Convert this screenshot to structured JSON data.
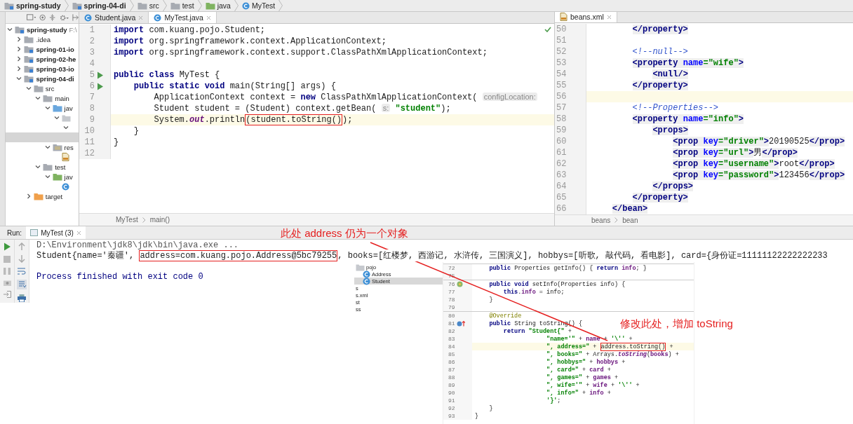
{
  "breadcrumbs": [
    {
      "label": "spring-study",
      "kind": "module"
    },
    {
      "label": "spring-04-di",
      "kind": "module"
    },
    {
      "label": "src",
      "kind": "folder"
    },
    {
      "label": "test",
      "kind": "folder"
    },
    {
      "label": "java",
      "kind": "testsource"
    },
    {
      "label": "MyTest",
      "kind": "class"
    }
  ],
  "project_tree": [
    {
      "label": "spring-study",
      "note": "F:\\",
      "kind": "module",
      "expanded": true,
      "selected": false,
      "children": [
        {
          "label": ".idea",
          "kind": "folder",
          "expanded": false,
          "selected": false
        },
        {
          "label": "spring-01-io",
          "kind": "module",
          "expanded": false,
          "selected": false
        },
        {
          "label": "spring-02-he",
          "kind": "module",
          "expanded": false,
          "selected": false
        },
        {
          "label": "spring-03-io",
          "kind": "module",
          "expanded": false,
          "selected": false
        },
        {
          "label": "spring-04-di",
          "kind": "module",
          "expanded": true,
          "selected": false,
          "children": [
            {
              "label": "src",
              "kind": "folder",
              "expanded": true,
              "selected": false,
              "children": [
                {
                  "label": "main",
                  "kind": "folder",
                  "expanded": true,
                  "selected": false,
                  "children": [
                    {
                      "label": "jav",
                      "kind": "source",
                      "expanded": true,
                      "selected": false,
                      "children": [
                        {
                          "kind": "package",
                          "expanded": true,
                          "selected": false,
                          "children": [
                            {
                              "expanded": true,
                              "selected": false,
                              "children": [
                                {
                                  "selected": true
                                }
                              ]
                            }
                          ]
                        }
                      ]
                    },
                    {
                      "label": "res",
                      "kind": "resources",
                      "expanded": true,
                      "selected": false,
                      "children": [
                        {
                          "kind": "xml",
                          "selected": false
                        }
                      ]
                    }
                  ]
                },
                {
                  "label": "test",
                  "kind": "folder",
                  "expanded": true,
                  "selected": false,
                  "children": [
                    {
                      "label": "jav",
                      "kind": "testsource",
                      "expanded": true,
                      "selected": false,
                      "children": [
                        {
                          "kind": "class",
                          "selected": false
                        }
                      ]
                    }
                  ]
                }
              ]
            },
            {
              "label": "target",
              "kind": "excluded",
              "expanded": false,
              "selected": false
            }
          ]
        }
      ]
    }
  ],
  "editor": {
    "tabs": [
      {
        "label": "Student.java",
        "selected": false
      },
      {
        "label": "MyTest.java",
        "selected": true
      }
    ],
    "lines": [
      {
        "num": "1",
        "kind": "code",
        "current": false,
        "segs": [
          {
            "kind": "kw",
            "text": "import"
          },
          {
            "kind": "p",
            "text": " com.kuang.pojo.Student;"
          }
        ]
      },
      {
        "num": "2",
        "kind": "code",
        "current": false,
        "segs": [
          {
            "kind": "kw",
            "text": "import"
          },
          {
            "kind": "p",
            "text": " org.springframework.context.ApplicationContext;"
          }
        ]
      },
      {
        "num": "3",
        "kind": "code",
        "current": false,
        "segs": [
          {
            "kind": "kw",
            "text": "import"
          },
          {
            "kind": "p",
            "text": " org.springframework.context.support.ClassPathXmlApplicationContext;"
          }
        ]
      },
      {
        "num": "4",
        "kind": "code",
        "current": false
      },
      {
        "num": "5",
        "kind": "run",
        "current": false,
        "segs": [
          {
            "kind": "kw",
            "text": "public class"
          },
          {
            "kind": "p",
            "text": " MyTest {"
          }
        ]
      },
      {
        "num": "6",
        "kind": "run",
        "current": false,
        "segs": [
          {
            "kind": "kw",
            "text": "    public static void"
          },
          {
            "kind": "p",
            "text": " main(String[] args) {"
          }
        ]
      },
      {
        "num": "7",
        "kind": "code",
        "current": false,
        "segs": [
          {
            "kind": "p",
            "text": "        ApplicationContext context = "
          },
          {
            "kind": "kw",
            "text": "new"
          },
          {
            "kind": "p",
            "text": " ClassPathXmlApplicationContext( "
          },
          {
            "kind": "hint",
            "text": "configLocation:"
          }
        ]
      },
      {
        "num": "8",
        "kind": "code",
        "current": false,
        "segs": [
          {
            "kind": "p",
            "text": "        Student student = (Student) context.getBean( "
          },
          {
            "kind": "hint",
            "text": "s:"
          },
          {
            "kind": "str",
            "text": " \"student\""
          },
          {
            "kind": "p",
            "text": ");"
          }
        ]
      },
      {
        "num": "9",
        "kind": "code",
        "current": true,
        "segs": [
          {
            "kind": "p",
            "text": "        System."
          },
          {
            "kind": "it",
            "text": "out"
          },
          {
            "kind": "p",
            "text": ".println"
          },
          {
            "kind": "box",
            "text": "(student.toString()"
          },
          {
            "kind": "p",
            "text": ");"
          }
        ]
      },
      {
        "num": "10",
        "kind": "code",
        "current": false,
        "segs": [
          {
            "kind": "p",
            "text": "    }"
          }
        ]
      },
      {
        "num": "11",
        "kind": "code",
        "current": false,
        "segs": [
          {
            "kind": "p",
            "text": "}"
          }
        ]
      },
      {
        "num": "12",
        "kind": "code",
        "current": false
      }
    ],
    "breadcrumb": [
      "MyTest",
      "main()"
    ]
  },
  "xml_editor": {
    "tabs": [
      {
        "label": "beans.xml",
        "selected": true
      }
    ],
    "lines": [
      {
        "num": "50",
        "current": false,
        "segs": [
          {
            "kind": "tag",
            "text": "        </property>"
          }
        ]
      },
      {
        "num": "51",
        "current": false
      },
      {
        "num": "52",
        "current": false,
        "segs": [
          {
            "kind": "cmt",
            "text": "        <!--null-->"
          }
        ]
      },
      {
        "num": "53",
        "current": false,
        "segs": [
          {
            "kind": "tag",
            "text": "        <property "
          },
          {
            "kind": "attr",
            "text": "name"
          },
          {
            "kind": "val",
            "text": "=\"wife\""
          },
          {
            "kind": "tag",
            "text": ">"
          }
        ]
      },
      {
        "num": "54",
        "current": false,
        "segs": [
          {
            "kind": "tag",
            "text": "            <null/>"
          }
        ]
      },
      {
        "num": "55",
        "current": false,
        "segs": [
          {
            "kind": "tag",
            "text": "        </property>"
          }
        ]
      },
      {
        "num": "56",
        "current": true
      },
      {
        "num": "57",
        "current": false,
        "segs": [
          {
            "kind": "cmt",
            "text": "        <!--Properties-->"
          }
        ]
      },
      {
        "num": "58",
        "current": false,
        "segs": [
          {
            "kind": "tag",
            "text": "        <property "
          },
          {
            "kind": "attr",
            "text": "name"
          },
          {
            "kind": "val",
            "text": "=\"info\""
          },
          {
            "kind": "tag",
            "text": ">"
          }
        ]
      },
      {
        "num": "59",
        "current": false,
        "segs": [
          {
            "kind": "tag",
            "text": "            <props>"
          }
        ]
      },
      {
        "num": "60",
        "current": false,
        "segs": [
          {
            "kind": "tag",
            "text": "                <prop "
          },
          {
            "kind": "attr",
            "text": "key"
          },
          {
            "kind": "val",
            "text": "=\"driver\""
          },
          {
            "kind": "tag",
            "text": ">"
          },
          {
            "kind": "p",
            "text": "20190525"
          },
          {
            "kind": "tag",
            "text": "</prop>"
          }
        ]
      },
      {
        "num": "61",
        "current": false,
        "segs": [
          {
            "kind": "tag",
            "text": "                <prop "
          },
          {
            "kind": "attr",
            "text": "key"
          },
          {
            "kind": "val",
            "text": "=\"url\""
          },
          {
            "kind": "tag",
            "text": ">"
          },
          {
            "kind": "p",
            "text": "男"
          },
          {
            "kind": "tag",
            "text": "</prop>"
          }
        ]
      },
      {
        "num": "62",
        "current": false,
        "segs": [
          {
            "kind": "tag",
            "text": "                <prop "
          },
          {
            "kind": "attr",
            "text": "key"
          },
          {
            "kind": "val",
            "text": "=\"username\""
          },
          {
            "kind": "tag",
            "text": ">"
          },
          {
            "kind": "p",
            "text": "root"
          },
          {
            "kind": "tag",
            "text": "</prop>"
          }
        ]
      },
      {
        "num": "63",
        "current": false,
        "segs": [
          {
            "kind": "tag",
            "text": "                <prop "
          },
          {
            "kind": "attr",
            "text": "key"
          },
          {
            "kind": "val",
            "text": "=\"password\""
          },
          {
            "kind": "tag",
            "text": ">"
          },
          {
            "kind": "p",
            "text": "123456"
          },
          {
            "kind": "tag",
            "text": "</prop>"
          }
        ]
      },
      {
        "num": "64",
        "current": false,
        "segs": [
          {
            "kind": "tag",
            "text": "            </props>"
          }
        ]
      },
      {
        "num": "65",
        "current": false,
        "segs": [
          {
            "kind": "tag",
            "text": "        </property>"
          }
        ]
      },
      {
        "num": "66",
        "current": false,
        "segs": [
          {
            "kind": "tag",
            "text": "    </bean>"
          }
        ]
      }
    ],
    "breadcrumb": [
      "beans",
      "bean"
    ]
  },
  "run": {
    "label": "Run:",
    "tab": "MyTest (3)",
    "lines": [
      {
        "kind": "output",
        "segs": [
          {
            "kind": "gray",
            "text": "D:\\Environment\\jdk8\\jdk\\bin\\java.exe ..."
          }
        ]
      },
      {
        "kind": "output",
        "segs": [
          {
            "kind": "p",
            "text": "Student{name='秦疆', "
          },
          {
            "kind": "box",
            "text": "address=com.kuang.pojo.Address@5bc79255"
          },
          {
            "kind": "p",
            "text": ", books=[红楼梦, 西游记, 水浒传, 三国演义], hobbys=[听歌, 敲代码, 看电影], card={身份证=11111122222222233"
          }
        ]
      },
      {
        "kind": "blank"
      },
      {
        "kind": "output",
        "segs": [
          {
            "kind": "blue",
            "text": "Process finished with exit code 0"
          }
        ]
      }
    ]
  },
  "inset": {
    "tree": [
      {
        "label": "pojo",
        "kind": "package",
        "selected": false,
        "children": [
          {
            "label": "Address",
            "kind": "class",
            "selected": false
          },
          {
            "label": "Student",
            "kind": "class",
            "selected": true
          }
        ]
      },
      {
        "label": "s",
        "kind": "text",
        "selected": false
      },
      {
        "label": "s.xml",
        "kind": "text",
        "selected": false
      },
      {
        "label": "st",
        "kind": "text",
        "selected": false
      },
      {
        "label": "ss",
        "kind": "text",
        "selected": false
      }
    ],
    "lines": [
      {
        "num": "72",
        "kind": "code",
        "current": false,
        "separator": true,
        "segs": [
          {
            "kind": "kw",
            "text": "    public"
          },
          {
            "kind": "p",
            "text": " Properties getInfo() { "
          },
          {
            "kind": "kw",
            "text": "return"
          },
          {
            "kind": "fld",
            "text": " info"
          },
          {
            "kind": "p",
            "text": "; }"
          }
        ]
      },
      {
        "num": "75",
        "kind": "code",
        "current": false,
        "separator": false
      },
      {
        "num": "76",
        "kind": "impl",
        "current": false,
        "separator": true,
        "segs": [
          {
            "kind": "kw",
            "text": "    public void"
          },
          {
            "kind": "p",
            "text": " setInfo(Properties info) {"
          }
        ]
      },
      {
        "num": "77",
        "kind": "code",
        "current": false,
        "separator": false,
        "segs": [
          {
            "kind": "kw",
            "text": "        this"
          },
          {
            "kind": "p",
            "text": "."
          },
          {
            "kind": "fld",
            "text": "info"
          },
          {
            "kind": "p",
            "text": " = info;"
          }
        ]
      },
      {
        "num": "78",
        "kind": "code",
        "current": false,
        "separator": false,
        "segs": [
          {
            "kind": "p",
            "text": "    }"
          }
        ]
      },
      {
        "num": "79",
        "kind": "code",
        "current": false,
        "separator": false
      },
      {
        "num": "80",
        "kind": "code",
        "current": false,
        "separator": true,
        "segs": [
          {
            "kind": "ann",
            "text": "    @Override"
          }
        ]
      },
      {
        "num": "81",
        "kind": "override",
        "current": false,
        "separator": false,
        "segs": [
          {
            "kind": "kw",
            "text": "    public"
          },
          {
            "kind": "p",
            "text": " String toString() {"
          }
        ]
      },
      {
        "num": "82",
        "kind": "code",
        "current": false,
        "separator": false,
        "segs": [
          {
            "kind": "kw",
            "text": "        return"
          },
          {
            "kind": "str",
            "text": " \"Student{\""
          },
          {
            "kind": "p",
            "text": " +"
          }
        ]
      },
      {
        "num": "83",
        "kind": "code",
        "current": false,
        "separator": false,
        "segs": [
          {
            "kind": "str",
            "text": "                    \"name='\""
          },
          {
            "kind": "p",
            "text": " + "
          },
          {
            "kind": "fld",
            "text": "name"
          },
          {
            "kind": "p",
            "text": " + "
          },
          {
            "kind": "str",
            "text": "'\\''"
          },
          {
            "kind": "p",
            "text": " +"
          }
        ]
      },
      {
        "num": "84",
        "kind": "code",
        "current": true,
        "separator": false,
        "segs": [
          {
            "kind": "str",
            "text": "                    \", address=\""
          },
          {
            "kind": "p",
            "text": " + "
          },
          {
            "kind": "box",
            "text": "address.toString()"
          },
          {
            "kind": "p",
            "text": " +"
          }
        ]
      },
      {
        "num": "85",
        "kind": "code",
        "current": false,
        "separator": false,
        "segs": [
          {
            "kind": "str",
            "text": "                    \", books=\""
          },
          {
            "kind": "p",
            "text": " + Arrays."
          },
          {
            "kind": "it",
            "text": "toString"
          },
          {
            "kind": "p",
            "text": "("
          },
          {
            "kind": "fld",
            "text": "books"
          },
          {
            "kind": "p",
            "text": ") +"
          }
        ]
      },
      {
        "num": "86",
        "kind": "code",
        "current": false,
        "separator": false,
        "segs": [
          {
            "kind": "str",
            "text": "                    \", hobbys=\""
          },
          {
            "kind": "p",
            "text": " + "
          },
          {
            "kind": "fld",
            "text": "hobbys"
          },
          {
            "kind": "p",
            "text": " +"
          }
        ]
      },
      {
        "num": "87",
        "kind": "code",
        "current": false,
        "separator": false,
        "segs": [
          {
            "kind": "str",
            "text": "                    \", card=\""
          },
          {
            "kind": "p",
            "text": " + "
          },
          {
            "kind": "fld",
            "text": "card"
          },
          {
            "kind": "p",
            "text": " +"
          }
        ]
      },
      {
        "num": "88",
        "kind": "code",
        "current": false,
        "separator": false,
        "segs": [
          {
            "kind": "str",
            "text": "                    \", games=\""
          },
          {
            "kind": "p",
            "text": " + "
          },
          {
            "kind": "fld",
            "text": "games"
          },
          {
            "kind": "p",
            "text": " +"
          }
        ]
      },
      {
        "num": "89",
        "kind": "code",
        "current": false,
        "separator": false,
        "segs": [
          {
            "kind": "str",
            "text": "                    \", wife='\""
          },
          {
            "kind": "p",
            "text": " + "
          },
          {
            "kind": "fld",
            "text": "wife"
          },
          {
            "kind": "p",
            "text": " + "
          },
          {
            "kind": "str",
            "text": "'\\''"
          },
          {
            "kind": "p",
            "text": " +"
          }
        ]
      },
      {
        "num": "90",
        "kind": "code",
        "current": false,
        "separator": false,
        "segs": [
          {
            "kind": "str",
            "text": "                    \", info=\""
          },
          {
            "kind": "p",
            "text": " + "
          },
          {
            "kind": "fld",
            "text": "info"
          },
          {
            "kind": "p",
            "text": " +"
          }
        ]
      },
      {
        "num": "91",
        "kind": "code",
        "current": false,
        "separator": false,
        "segs": [
          {
            "kind": "str",
            "text": "                    '}'"
          },
          {
            "kind": "p",
            "text": ";"
          }
        ]
      },
      {
        "num": "92",
        "kind": "code",
        "current": false,
        "separator": false,
        "segs": [
          {
            "kind": "p",
            "text": "    }"
          }
        ]
      },
      {
        "num": "93",
        "kind": "code",
        "current": false,
        "separator": false,
        "segs": [
          {
            "kind": "p",
            "text": "}"
          }
        ]
      }
    ]
  },
  "annotations": [
    {
      "text": "此处 address 仍为一个对象"
    },
    {
      "text": "修改此处，增加 toString"
    }
  ]
}
